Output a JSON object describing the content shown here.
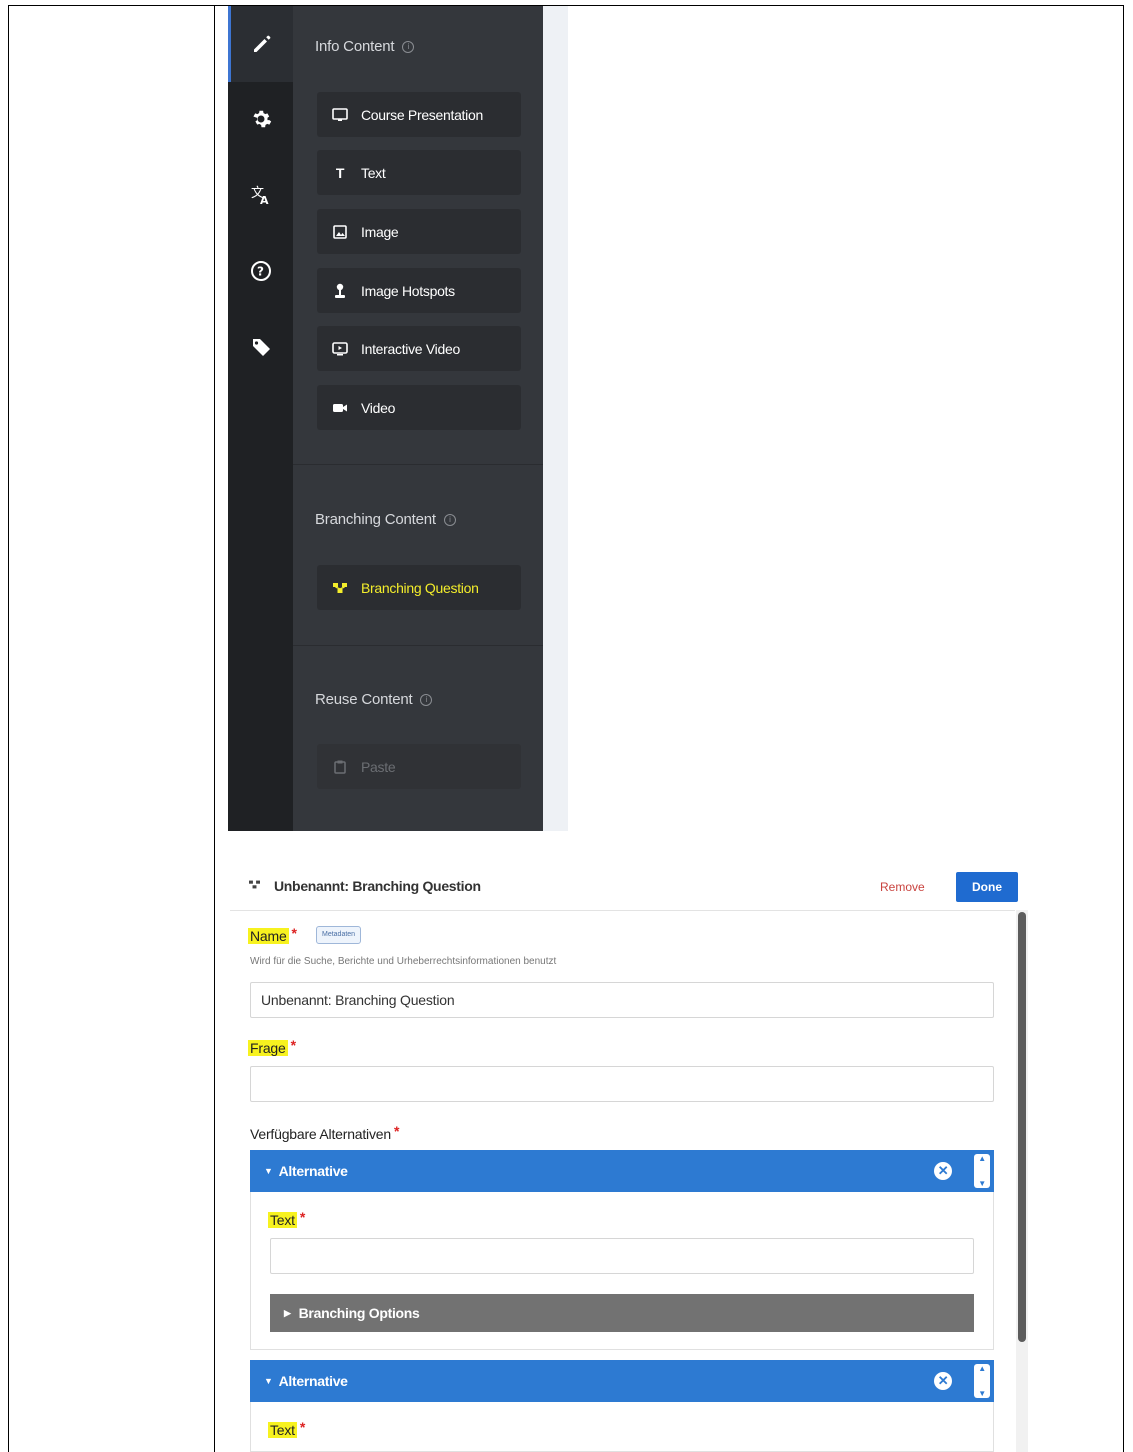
{
  "menu": {
    "sections": [
      {
        "title": "Info Content",
        "items": [
          {
            "label": "Course Presentation",
            "icon": "presentation-icon"
          },
          {
            "label": "Text",
            "icon": "text-icon"
          },
          {
            "label": "Image",
            "icon": "image-icon"
          },
          {
            "label": "Image Hotspots",
            "icon": "hotspot-icon"
          },
          {
            "label": "Interactive Video",
            "icon": "interactive-video-icon"
          },
          {
            "label": "Video",
            "icon": "video-icon"
          }
        ]
      },
      {
        "title": "Branching Content",
        "items": [
          {
            "label": "Branching Question",
            "icon": "branching-icon",
            "highlighted": true
          }
        ]
      },
      {
        "title": "Reuse Content",
        "items": [
          {
            "label": "Paste",
            "icon": "clipboard-icon",
            "disabled": true
          }
        ]
      }
    ],
    "rail_icons": [
      "pencil-icon",
      "gear-icon",
      "translate-icon",
      "help-icon",
      "tag-icon"
    ]
  },
  "form": {
    "header_title": "Unbenannt: Branching Question",
    "remove_label": "Remove",
    "done_label": "Done",
    "name_label": "Name",
    "metadata_label": "Metadaten",
    "name_description": "Wird für die Suche, Berichte und Urheberrechtsinformationen benutzt",
    "name_value": "Unbenannt: Branching Question",
    "question_label": "Frage",
    "question_value": "",
    "alternatives_label": "Verfügbare Alternativen",
    "alternatives": [
      {
        "header": "Alternative",
        "text_label": "Text",
        "text_value": "",
        "options_label": "Branching Options"
      },
      {
        "header": "Alternative",
        "text_label": "Text"
      }
    ]
  },
  "colors": {
    "accent_blue": "#2d7ad2",
    "highlight_yellow": "#f7f21f",
    "remove_red": "#c9433f"
  }
}
